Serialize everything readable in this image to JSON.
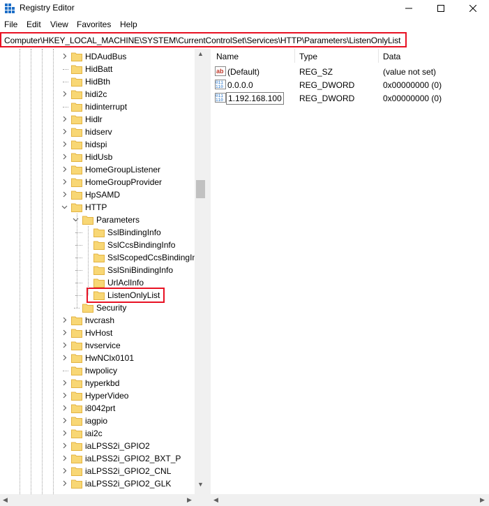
{
  "window": {
    "title": "Registry Editor",
    "minimize": "—",
    "maximize": "☐",
    "close": "✕"
  },
  "menu": [
    "File",
    "Edit",
    "View",
    "Favorites",
    "Help"
  ],
  "address": "Computer\\HKEY_LOCAL_MACHINE\\SYSTEM\\CurrentControlSet\\Services\\HTTP\\Parameters\\ListenOnlyList",
  "tree": {
    "items": [
      {
        "label": "HDAudBus",
        "expandable": true
      },
      {
        "label": "HidBatt",
        "expandable": false
      },
      {
        "label": "HidBth",
        "expandable": false
      },
      {
        "label": "hidi2c",
        "expandable": true
      },
      {
        "label": "hidinterrupt",
        "expandable": false
      },
      {
        "label": "Hidlr",
        "expandable": true
      },
      {
        "label": "hidserv",
        "expandable": true
      },
      {
        "label": "hidspi",
        "expandable": true
      },
      {
        "label": "HidUsb",
        "expandable": true
      },
      {
        "label": "HomeGroupListener",
        "expandable": true
      },
      {
        "label": "HomeGroupProvider",
        "expandable": true
      },
      {
        "label": "HpSAMD",
        "expandable": true
      },
      {
        "label": "HTTP",
        "expandable": true,
        "expanded": true
      },
      {
        "label": "Parameters",
        "expandable": true,
        "expanded": true,
        "level": 1
      },
      {
        "label": "SslBindingInfo",
        "level": 2
      },
      {
        "label": "SslCcsBindingInfo",
        "level": 2
      },
      {
        "label": "SslScopedCcsBindingInfo",
        "level": 2
      },
      {
        "label": "SslSniBindingInfo",
        "level": 2
      },
      {
        "label": "UrlAclInfo",
        "level": 2
      },
      {
        "label": "ListenOnlyList",
        "level": 2,
        "selected": true
      },
      {
        "label": "Security",
        "level": 1
      },
      {
        "label": "hvcrash",
        "expandable": true
      },
      {
        "label": "HvHost",
        "expandable": true
      },
      {
        "label": "hvservice",
        "expandable": true
      },
      {
        "label": "HwNClx0101",
        "expandable": true
      },
      {
        "label": "hwpolicy",
        "expandable": false
      },
      {
        "label": "hyperkbd",
        "expandable": true
      },
      {
        "label": "HyperVideo",
        "expandable": true
      },
      {
        "label": "i8042prt",
        "expandable": true
      },
      {
        "label": "iagpio",
        "expandable": true
      },
      {
        "label": "iai2c",
        "expandable": true
      },
      {
        "label": "iaLPSS2i_GPIO2",
        "expandable": true
      },
      {
        "label": "iaLPSS2i_GPIO2_BXT_P",
        "expandable": true
      },
      {
        "label": "iaLPSS2i_GPIO2_CNL",
        "expandable": true
      },
      {
        "label": "iaLPSS2i_GPIO2_GLK",
        "expandable": true
      }
    ]
  },
  "columns": {
    "name": "Name",
    "type": "Type",
    "data": "Data"
  },
  "values": [
    {
      "name": "(Default)",
      "type": "REG_SZ",
      "data": "(value not set)",
      "icon": "string-value-icon"
    },
    {
      "name": "0.0.0.0",
      "type": "REG_DWORD",
      "data": "0x00000000 (0)",
      "icon": "dword-value-icon"
    },
    {
      "name": "1.192.168.100",
      "type": "REG_DWORD",
      "data": "0x00000000 (0)",
      "icon": "dword-value-icon"
    }
  ],
  "colors": {
    "highlight": "#e81123",
    "folder": "#f8d775",
    "folder_dark": "#e3b341"
  }
}
